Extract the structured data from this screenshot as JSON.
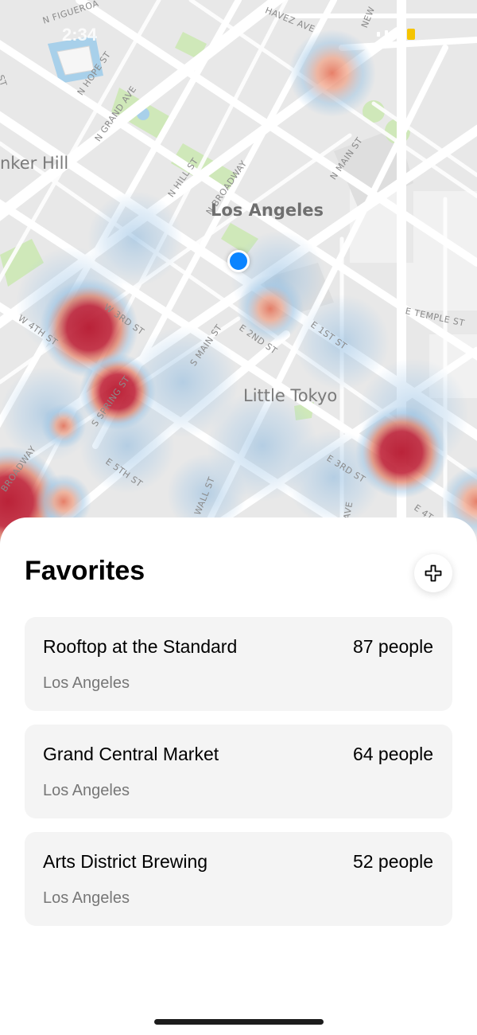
{
  "status_bar": {
    "time": "2:34"
  },
  "map": {
    "city_label": "Los Angeles",
    "district_label": "Little Tokyo",
    "neighborhood_label": "nker Hill",
    "streets": {
      "figueroa": "N FIGUEROA",
      "chavez": "HAVEZ AVE",
      "new": "NEW",
      "hope": "N HOPE ST",
      "grand": "N GRAND AVE",
      "hill": "N HILL ST",
      "broadway_n": "N BROADWAY",
      "main_n": "N MAIN ST",
      "main_s": "S MAIN ST",
      "third_w": "W 3RD ST",
      "fourth_w": "W 4TH ST",
      "spring_s": "S SPRING ST",
      "second_e": "E 2ND ST",
      "first_e": "E 1ST ST",
      "temple_e": "E TEMPLE ST",
      "broadway_s": "BROADWAY",
      "fifth_e": "E 5TH ST",
      "wall": "WALL ST",
      "third_e": "E 3RD ST",
      "ave": "AVE",
      "fourth_e": "E 4T",
      "st_edge": "ST"
    },
    "heat_color_hot": "#c0253a",
    "heat_color_cool": "#8ab8df",
    "user_location_color": "#0a84ff"
  },
  "favorites": {
    "title": "Favorites",
    "add_icon": "plus-icon",
    "items": [
      {
        "name": "Rooftop at the Standard",
        "count": "87 people",
        "city": "Los Angeles"
      },
      {
        "name": "Grand Central Market",
        "count": "64 people",
        "city": "Los Angeles"
      },
      {
        "name": "Arts District Brewing",
        "count": "52 people",
        "city": "Los Angeles"
      }
    ]
  }
}
